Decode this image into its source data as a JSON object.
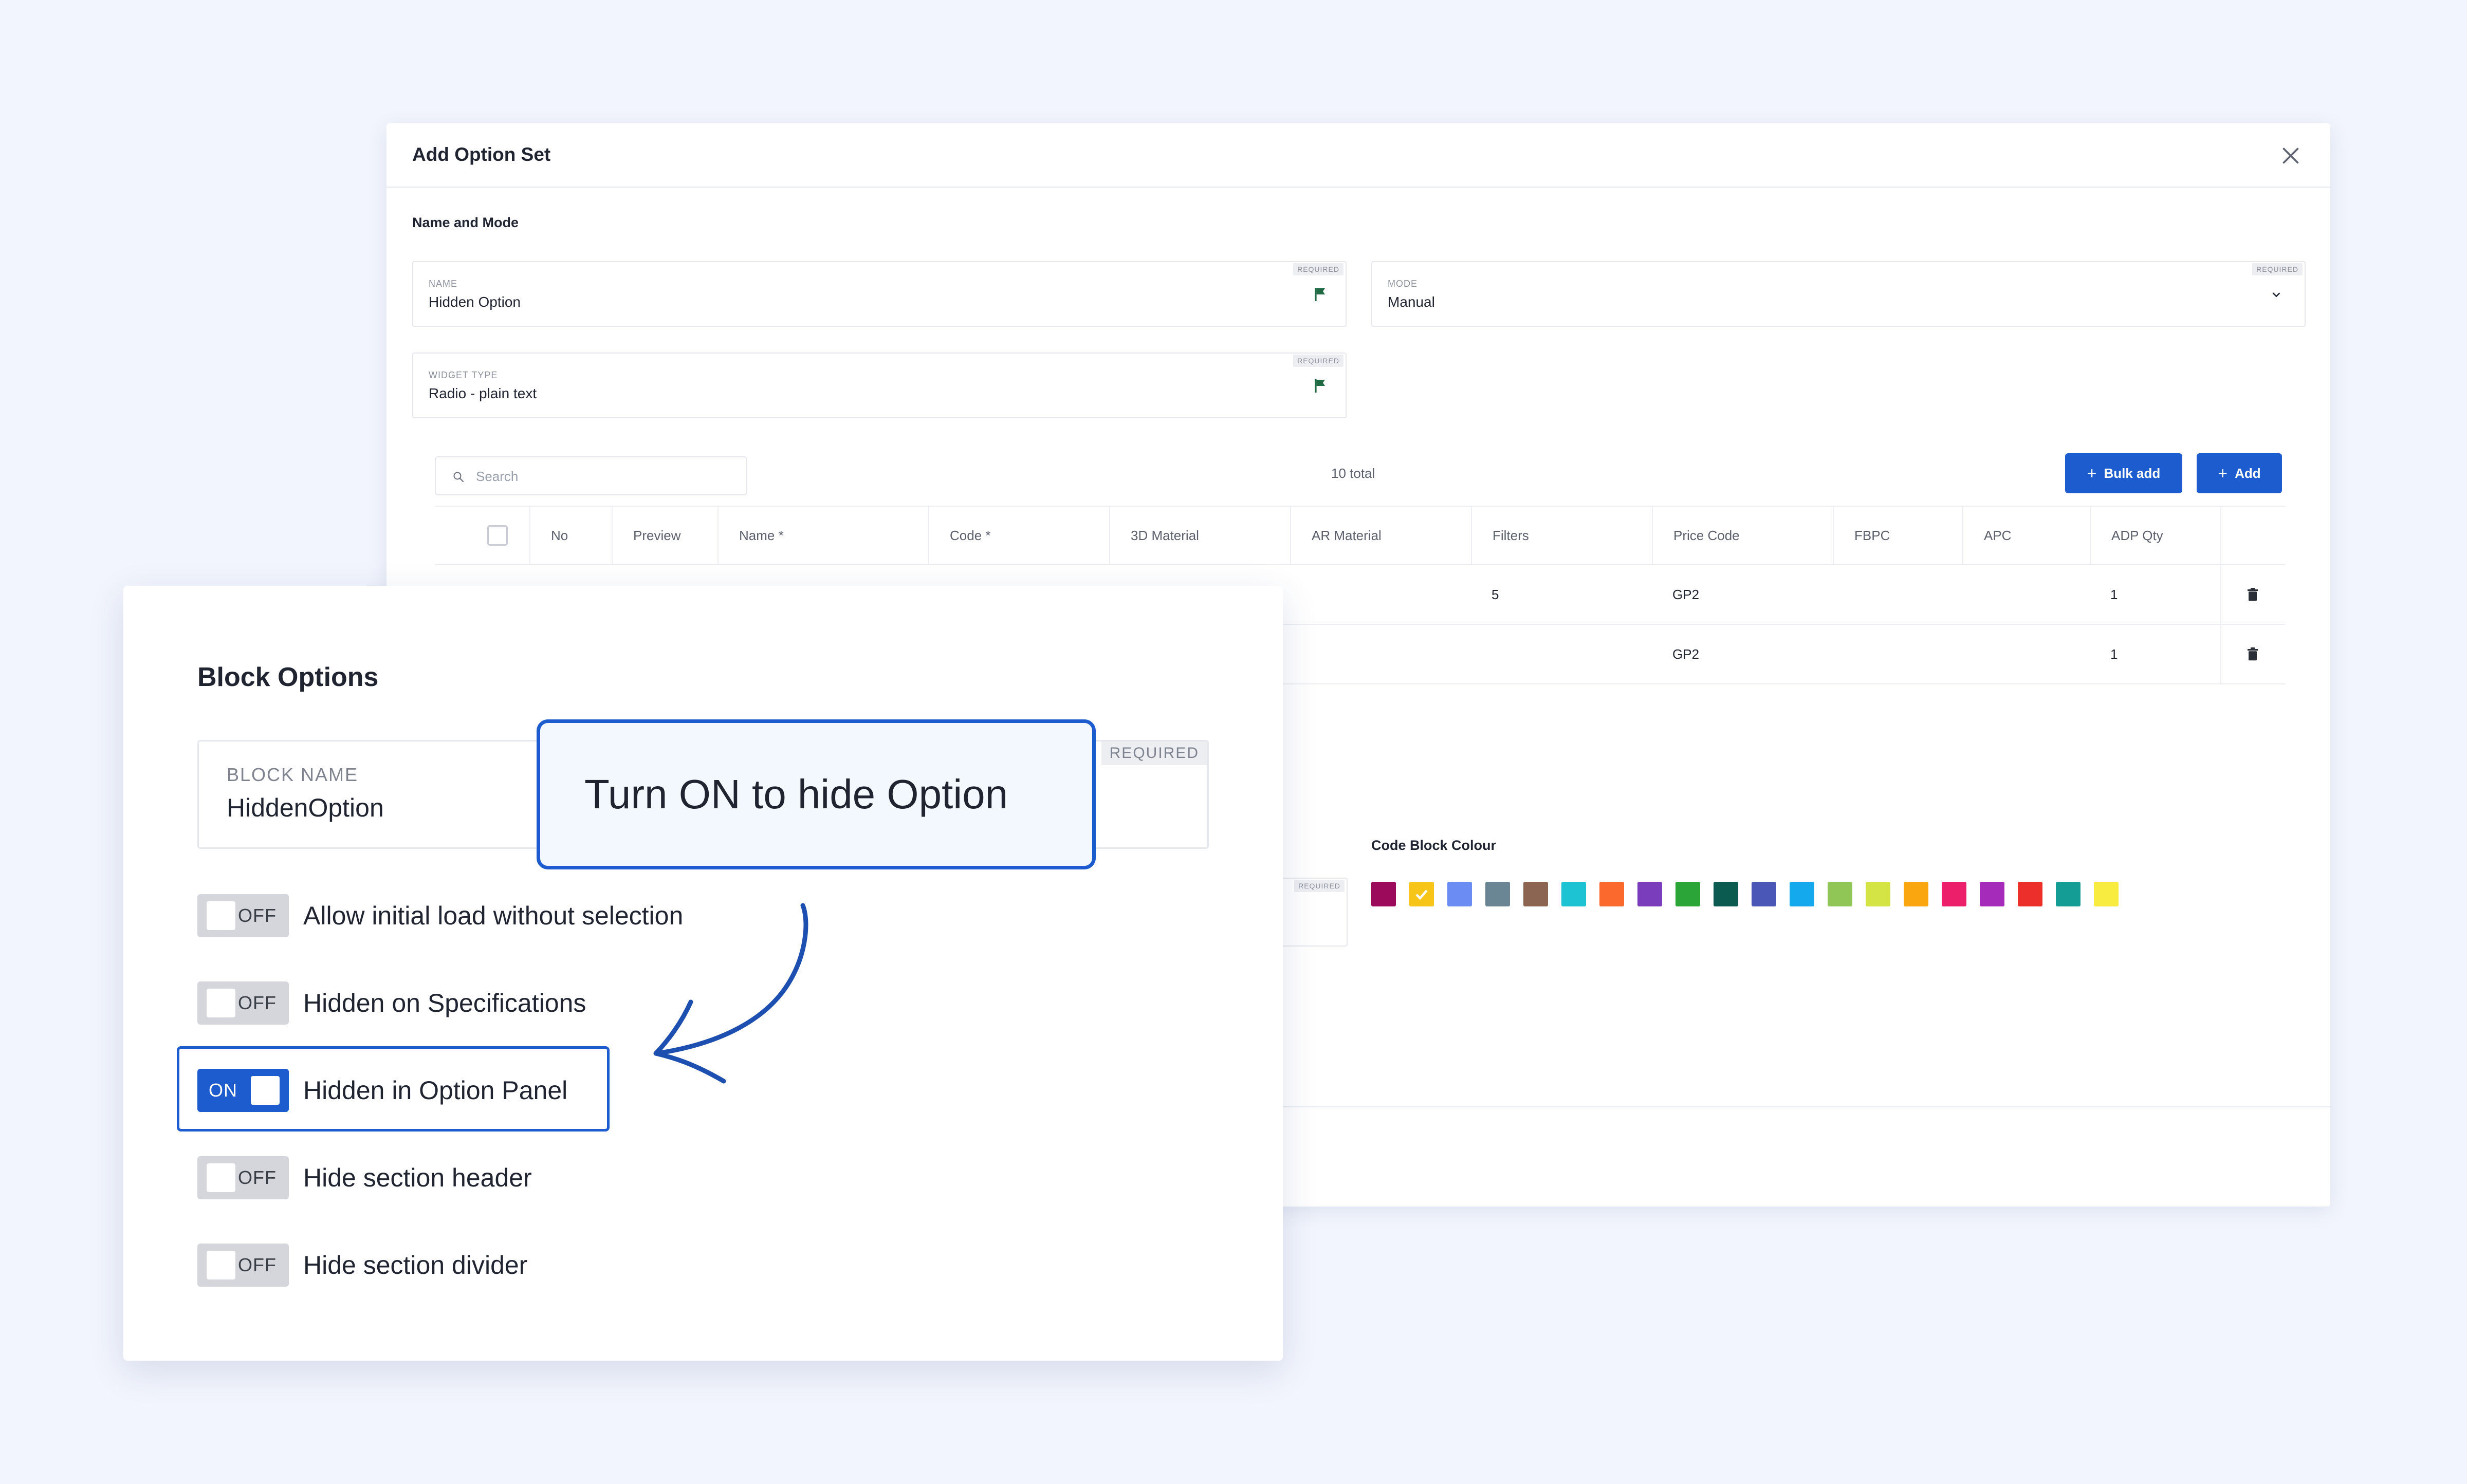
{
  "modal": {
    "title": "Add Option Set",
    "section_title": "Name and Mode",
    "required_tag": "REQUIRED",
    "name_field": {
      "label": "NAME",
      "value": "Hidden Option"
    },
    "mode_field": {
      "label": "MODE",
      "value": "Manual"
    },
    "widget_field": {
      "label": "WIDGET TYPE",
      "value": "Radio - plain text"
    },
    "search": {
      "placeholder": "Search"
    },
    "total": "10 total",
    "bulk_add_label": "Bulk add",
    "add_label": "Add",
    "table": {
      "columns": [
        "No",
        "Preview",
        "Name *",
        "Code *",
        "3D Material",
        "AR Material",
        "Filters",
        "Price Code",
        "FBPC",
        "APC",
        "ADP Qty"
      ],
      "rows": [
        {
          "filters": "5",
          "price_code": "GP2",
          "adp_qty": "1"
        },
        {
          "filters": "",
          "price_code": "GP2",
          "adp_qty": "1"
        }
      ]
    },
    "colour_title": "Code Block Colour",
    "colours": [
      "#9c0a5b",
      "#f7c518",
      "#6a8cf3",
      "#6a8593",
      "#8b6551",
      "#1ec3d3",
      "#fb6a2c",
      "#7a3dbb",
      "#2ba537",
      "#0c5b50",
      "#4a57b6",
      "#14a9ec",
      "#8fc655",
      "#d5e445",
      "#f9a60f",
      "#ec1f6a",
      "#a52cba",
      "#ec2f2a",
      "#149d94",
      "#f9ec40"
    ],
    "selected_colour": "#f7c518"
  },
  "panel": {
    "title": "Block Options",
    "block_name": {
      "label": "BLOCK NAME",
      "value": "HiddenOption",
      "required": "REQUIRED"
    },
    "on_text": "ON",
    "off_text": "OFF",
    "toggles": [
      {
        "label": "Allow initial load without selection",
        "state": "off"
      },
      {
        "label": "Hidden on Specifications",
        "state": "off"
      },
      {
        "label": "Hidden in Option Panel",
        "state": "on"
      },
      {
        "label": "Hide section header",
        "state": "off"
      },
      {
        "label": "Hide section divider",
        "state": "off"
      }
    ]
  },
  "callout": {
    "text": "Turn ON to hide Option"
  },
  "colors": {
    "accent": "#1c5ccf",
    "background": "#f2f5fd",
    "flag": "#1e6b43"
  },
  "icons": [
    "close-icon",
    "flag-icon",
    "chevron-down-icon",
    "search-icon",
    "plus-icon",
    "trash-icon",
    "check-icon",
    "curved-arrow-icon"
  ]
}
